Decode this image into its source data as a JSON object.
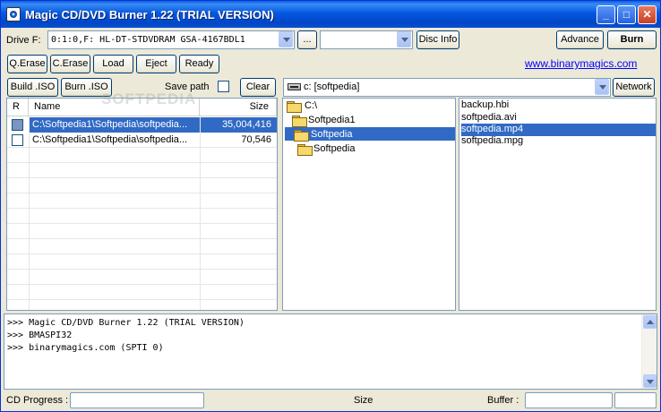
{
  "window": {
    "title": "Magic CD/DVD Burner 1.22 (TRIAL VERSION)",
    "minimize": "_",
    "maximize": "□",
    "close": "✕"
  },
  "drive": {
    "label": "Drive F:",
    "selected": "0:1:0,F: HL-DT-STDVDRAM GSA-4167BDL1",
    "more_button": "...",
    "second_selected": "",
    "disc_info_button": "Disc Info",
    "advance_button": "Advance",
    "burn_button": "Burn"
  },
  "toolbar": {
    "q_erase": "Q.Erase",
    "c_erase": "C.Erase",
    "load": "Load",
    "eject": "Eject",
    "ready": "Ready",
    "website": "www.binarymagics.com"
  },
  "iso": {
    "build": "Build .ISO",
    "burn": "Burn .ISO",
    "save_path_label": "Save path",
    "save_path_checked": false,
    "clear": "Clear"
  },
  "file_list": {
    "columns": {
      "r": "R",
      "name": "Name",
      "size": "Size"
    },
    "rows": [
      {
        "name": "C:\\Softpedia1\\Softpedia\\softpedia...",
        "size": "35,004,416",
        "selected": true
      },
      {
        "name": "C:\\Softpedia1\\Softpedia\\softpedia...",
        "size": "70,546",
        "selected": false
      }
    ]
  },
  "watermark": "SOFTPEDIA",
  "location": {
    "selected": "c: [softpedia]",
    "network_button": "Network"
  },
  "tree": [
    {
      "label": "C:\\",
      "level": 0,
      "open": true,
      "selected": false
    },
    {
      "label": "Softpedia1",
      "level": 1,
      "open": true,
      "selected": false
    },
    {
      "label": "Softpedia",
      "level": 1,
      "open": true,
      "selected": true
    },
    {
      "label": "Softpedia",
      "level": 2,
      "open": false,
      "selected": false
    }
  ],
  "files": [
    {
      "name": "backup.hbi",
      "selected": false
    },
    {
      "name": "softpedia.avi",
      "selected": false
    },
    {
      "name": "softpedia.mp4",
      "selected": true
    },
    {
      "name": "softpedia.mpg",
      "selected": false
    }
  ],
  "log": [
    ">>> Magic CD/DVD Burner 1.22 (TRIAL VERSION)",
    ">>> BMASPI32",
    ">>> binarymagics.com (SPTI 0)"
  ],
  "status": {
    "cd_progress_label": "CD Progress :",
    "size_label": "Size",
    "buffer_label": "Buffer :"
  }
}
